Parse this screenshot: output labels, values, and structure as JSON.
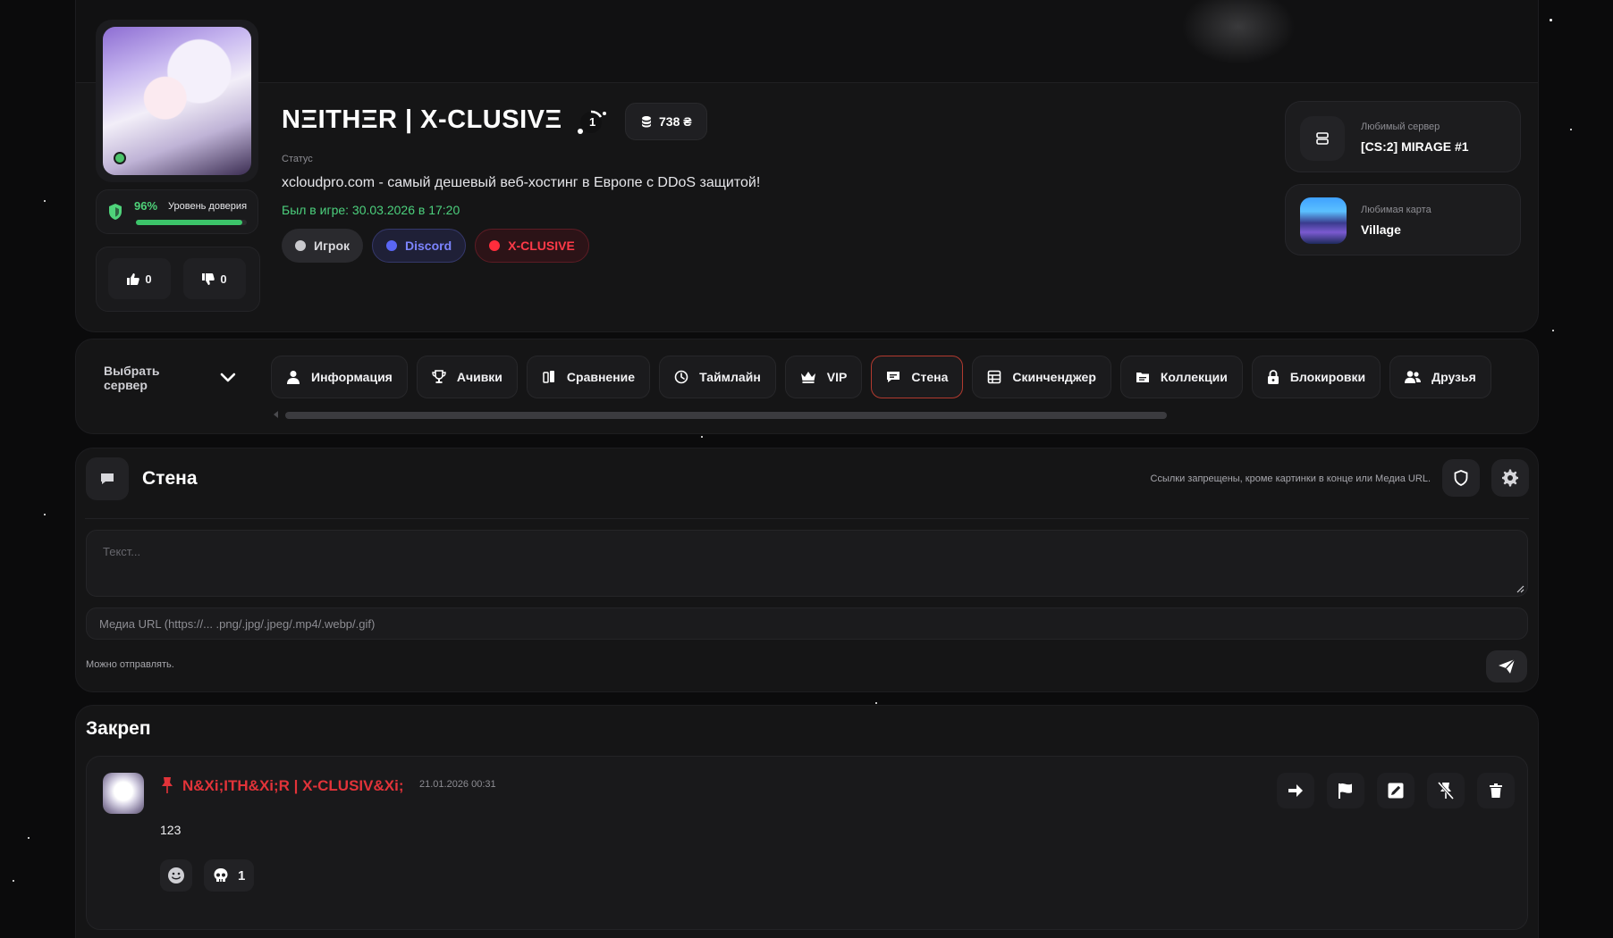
{
  "profile": {
    "nickname": "NΞITHΞR | X-CLUSIVΞ",
    "level": "1",
    "balance": "738 ₴",
    "status_label": "Статус",
    "status_text": "xcloudpro.com - самый дешевый веб-хостинг в Европе с DDoS защитой!",
    "last_seen": "Был в игре: 30.03.2026 в 17:20",
    "trust_percent": "96%",
    "trust_level": 0.96,
    "trust_label": "Уровень доверия",
    "likes": "0",
    "dislikes": "0",
    "tags": [
      {
        "label": "Игрок",
        "color": "#c9c9cd"
      },
      {
        "label": "Discord",
        "color": "#5a66f5"
      },
      {
        "label": "X-CLUSIVE",
        "color": "#ff2d3c"
      }
    ],
    "favorite_server": {
      "label": "Любимый сервер",
      "value": "[CS:2] MIRAGE #1"
    },
    "favorite_map": {
      "label": "Любимая карта",
      "value": "Village"
    }
  },
  "nav": {
    "server_select": "Выбрать сервер",
    "active_tab": "Стена",
    "accent_color": "#b23a2f",
    "tabs": [
      {
        "label": "Информация",
        "icon": "user-icon"
      },
      {
        "label": "Ачивки",
        "icon": "trophy-icon"
      },
      {
        "label": "Сравнение",
        "icon": "compare-icon"
      },
      {
        "label": "Таймлайн",
        "icon": "clock-icon"
      },
      {
        "label": "VIP",
        "icon": "crown-icon"
      },
      {
        "label": "Стена",
        "icon": "chat-icon"
      },
      {
        "label": "Скинченджер",
        "icon": "grid-icon"
      },
      {
        "label": "Коллекции",
        "icon": "folder-icon"
      },
      {
        "label": "Блокировки",
        "icon": "lock-icon"
      },
      {
        "label": "Друзья",
        "icon": "users-icon"
      }
    ]
  },
  "wall": {
    "title": "Стена",
    "rules": "Ссылки запрещены, кроме картинки в конце или Медиа URL.",
    "text_placeholder": "Текст...",
    "media_placeholder": "Медиа URL (https://... .png/.jpg/.jpeg/.mp4/.webp/.gif)",
    "can_send": "Можно отправлять."
  },
  "pinned": {
    "title": "Закреп",
    "post": {
      "author": "N&Xi;ITH&Xi;R | X-CLUSIV&Xi;",
      "date": "21.01.2026 00:31",
      "text": "123",
      "reaction_count": "1"
    }
  }
}
